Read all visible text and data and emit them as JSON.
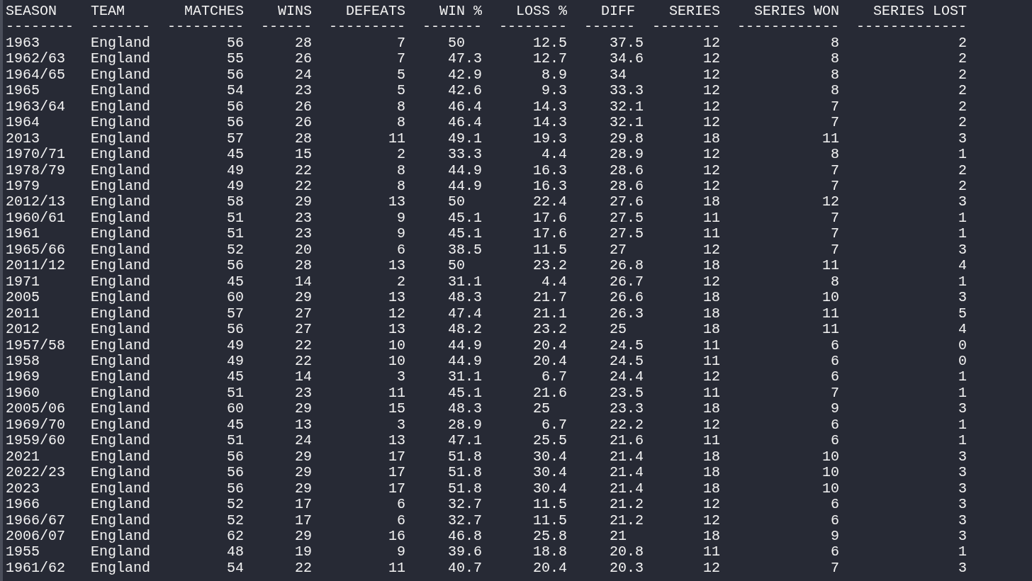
{
  "columns": [
    {
      "label": "SEASON",
      "rule": "--------",
      "kind": "text"
    },
    {
      "label": "TEAM",
      "rule": "-------",
      "kind": "text"
    },
    {
      "label": "MATCHES",
      "rule": "---------",
      "kind": "int"
    },
    {
      "label": "WINS",
      "rule": "------",
      "kind": "int"
    },
    {
      "label": "DEFEATS",
      "rule": "---------",
      "kind": "int"
    },
    {
      "label": "WIN %",
      "rule": "-------",
      "kind": "float"
    },
    {
      "label": "LOSS %",
      "rule": "--------",
      "kind": "float"
    },
    {
      "label": "DIFF",
      "rule": "------",
      "kind": "float"
    },
    {
      "label": "SERIES",
      "rule": "--------",
      "kind": "int"
    },
    {
      "label": "SERIES WON",
      "rule": "------------",
      "kind": "int"
    },
    {
      "label": "SERIES LOST",
      "rule": "-------------",
      "kind": "int"
    }
  ],
  "rows": [
    [
      "1963",
      "England",
      "56",
      "28",
      "7",
      "50",
      "12.5",
      "37.5",
      "12",
      "8",
      "2"
    ],
    [
      "1962/63",
      "England",
      "55",
      "26",
      "7",
      "47.3",
      "12.7",
      "34.6",
      "12",
      "8",
      "2"
    ],
    [
      "1964/65",
      "England",
      "56",
      "24",
      "5",
      "42.9",
      "8.9",
      "34",
      "12",
      "8",
      "2"
    ],
    [
      "1965",
      "England",
      "54",
      "23",
      "5",
      "42.6",
      "9.3",
      "33.3",
      "12",
      "8",
      "2"
    ],
    [
      "1963/64",
      "England",
      "56",
      "26",
      "8",
      "46.4",
      "14.3",
      "32.1",
      "12",
      "7",
      "2"
    ],
    [
      "1964",
      "England",
      "56",
      "26",
      "8",
      "46.4",
      "14.3",
      "32.1",
      "12",
      "7",
      "2"
    ],
    [
      "2013",
      "England",
      "57",
      "28",
      "11",
      "49.1",
      "19.3",
      "29.8",
      "18",
      "11",
      "3"
    ],
    [
      "1970/71",
      "England",
      "45",
      "15",
      "2",
      "33.3",
      "4.4",
      "28.9",
      "12",
      "8",
      "1"
    ],
    [
      "1978/79",
      "England",
      "49",
      "22",
      "8",
      "44.9",
      "16.3",
      "28.6",
      "12",
      "7",
      "2"
    ],
    [
      "1979",
      "England",
      "49",
      "22",
      "8",
      "44.9",
      "16.3",
      "28.6",
      "12",
      "7",
      "2"
    ],
    [
      "2012/13",
      "England",
      "58",
      "29",
      "13",
      "50",
      "22.4",
      "27.6",
      "18",
      "12",
      "3"
    ],
    [
      "1960/61",
      "England",
      "51",
      "23",
      "9",
      "45.1",
      "17.6",
      "27.5",
      "11",
      "7",
      "1"
    ],
    [
      "1961",
      "England",
      "51",
      "23",
      "9",
      "45.1",
      "17.6",
      "27.5",
      "11",
      "7",
      "1"
    ],
    [
      "1965/66",
      "England",
      "52",
      "20",
      "6",
      "38.5",
      "11.5",
      "27",
      "12",
      "7",
      "3"
    ],
    [
      "2011/12",
      "England",
      "56",
      "28",
      "13",
      "50",
      "23.2",
      "26.8",
      "18",
      "11",
      "4"
    ],
    [
      "1971",
      "England",
      "45",
      "14",
      "2",
      "31.1",
      "4.4",
      "26.7",
      "12",
      "8",
      "1"
    ],
    [
      "2005",
      "England",
      "60",
      "29",
      "13",
      "48.3",
      "21.7",
      "26.6",
      "18",
      "10",
      "3"
    ],
    [
      "2011",
      "England",
      "57",
      "27",
      "12",
      "47.4",
      "21.1",
      "26.3",
      "18",
      "11",
      "5"
    ],
    [
      "2012",
      "England",
      "56",
      "27",
      "13",
      "48.2",
      "23.2",
      "25",
      "18",
      "11",
      "4"
    ],
    [
      "1957/58",
      "England",
      "49",
      "22",
      "10",
      "44.9",
      "20.4",
      "24.5",
      "11",
      "6",
      "0"
    ],
    [
      "1958",
      "England",
      "49",
      "22",
      "10",
      "44.9",
      "20.4",
      "24.5",
      "11",
      "6",
      "0"
    ],
    [
      "1969",
      "England",
      "45",
      "14",
      "3",
      "31.1",
      "6.7",
      "24.4",
      "12",
      "6",
      "1"
    ],
    [
      "1960",
      "England",
      "51",
      "23",
      "11",
      "45.1",
      "21.6",
      "23.5",
      "11",
      "7",
      "1"
    ],
    [
      "2005/06",
      "England",
      "60",
      "29",
      "15",
      "48.3",
      "25",
      "23.3",
      "18",
      "9",
      "3"
    ],
    [
      "1969/70",
      "England",
      "45",
      "13",
      "3",
      "28.9",
      "6.7",
      "22.2",
      "12",
      "6",
      "1"
    ],
    [
      "1959/60",
      "England",
      "51",
      "24",
      "13",
      "47.1",
      "25.5",
      "21.6",
      "11",
      "6",
      "1"
    ],
    [
      "2021",
      "England",
      "56",
      "29",
      "17",
      "51.8",
      "30.4",
      "21.4",
      "18",
      "10",
      "3"
    ],
    [
      "2022/23",
      "England",
      "56",
      "29",
      "17",
      "51.8",
      "30.4",
      "21.4",
      "18",
      "10",
      "3"
    ],
    [
      "2023",
      "England",
      "56",
      "29",
      "17",
      "51.8",
      "30.4",
      "21.4",
      "18",
      "10",
      "3"
    ],
    [
      "1966",
      "England",
      "52",
      "17",
      "6",
      "32.7",
      "11.5",
      "21.2",
      "12",
      "6",
      "3"
    ],
    [
      "1966/67",
      "England",
      "52",
      "17",
      "6",
      "32.7",
      "11.5",
      "21.2",
      "12",
      "6",
      "3"
    ],
    [
      "2006/07",
      "England",
      "62",
      "29",
      "16",
      "46.8",
      "25.8",
      "21",
      "18",
      "9",
      "3"
    ],
    [
      "1955",
      "England",
      "48",
      "19",
      "9",
      "39.6",
      "18.8",
      "20.8",
      "11",
      "6",
      "1"
    ],
    [
      "1961/62",
      "England",
      "54",
      "22",
      "11",
      "40.7",
      "20.4",
      "20.3",
      "12",
      "7",
      "3"
    ]
  ]
}
